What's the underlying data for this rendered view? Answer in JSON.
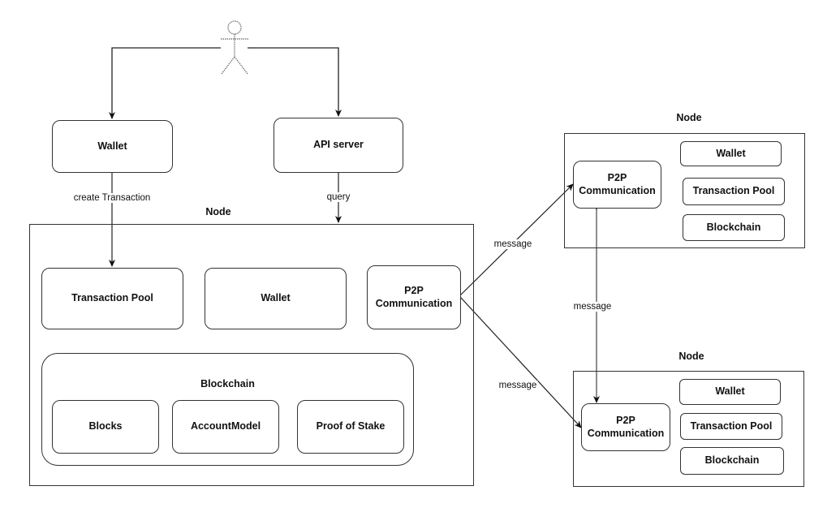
{
  "actor": {
    "icon": "user-actor-icon"
  },
  "top": {
    "wallet": "Wallet",
    "api_server": "API server"
  },
  "edge_labels": {
    "create_transaction": "create Transaction",
    "query": "query",
    "message_top": "message",
    "message_vertical": "message",
    "message_bottom": "message"
  },
  "main_node": {
    "title": "Node",
    "transaction_pool": "Transaction Pool",
    "wallet": "Wallet",
    "p2p": "P2P\nCommunication",
    "blockchain": {
      "title": "Blockchain",
      "items": [
        "Blocks",
        "AccountModel",
        "Proof of Stake"
      ]
    }
  },
  "peer_node_1": {
    "title": "Node",
    "p2p": "P2P\nCommunication",
    "items": [
      "Wallet",
      "Transaction Pool",
      "Blockchain"
    ]
  },
  "peer_node_2": {
    "title": "Node",
    "p2p": "P2P\nCommunication",
    "items": [
      "Wallet",
      "Transaction Pool",
      "Blockchain"
    ]
  }
}
